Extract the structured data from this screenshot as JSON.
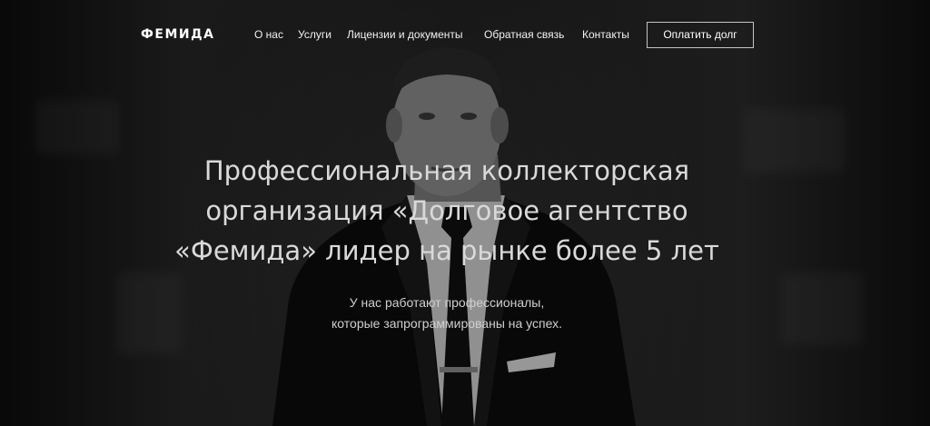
{
  "nav": {
    "logo": "ФЕМИДА",
    "items": [
      {
        "label": "О нас"
      },
      {
        "label": "Услуги"
      },
      {
        "label": "Лицензии и документы"
      },
      {
        "label": "Обратная связь"
      },
      {
        "label": "Контакты"
      }
    ],
    "pay_button": "Оплатить долг"
  },
  "hero": {
    "title_lines": [
      "Профессиональная коллекторская",
      "организация «Долговое агентство",
      "«Фемида» лидер на рынке более 5 лет"
    ],
    "subtitle_lines": [
      "У нас работают профессионалы,",
      "которые запрограммированы на успех."
    ],
    "background_image": "black-and-white-photo-man-in-suit"
  },
  "colors": {
    "text": "#ffffff",
    "title": "#d9d9d9",
    "background": "#1b1b1b"
  }
}
